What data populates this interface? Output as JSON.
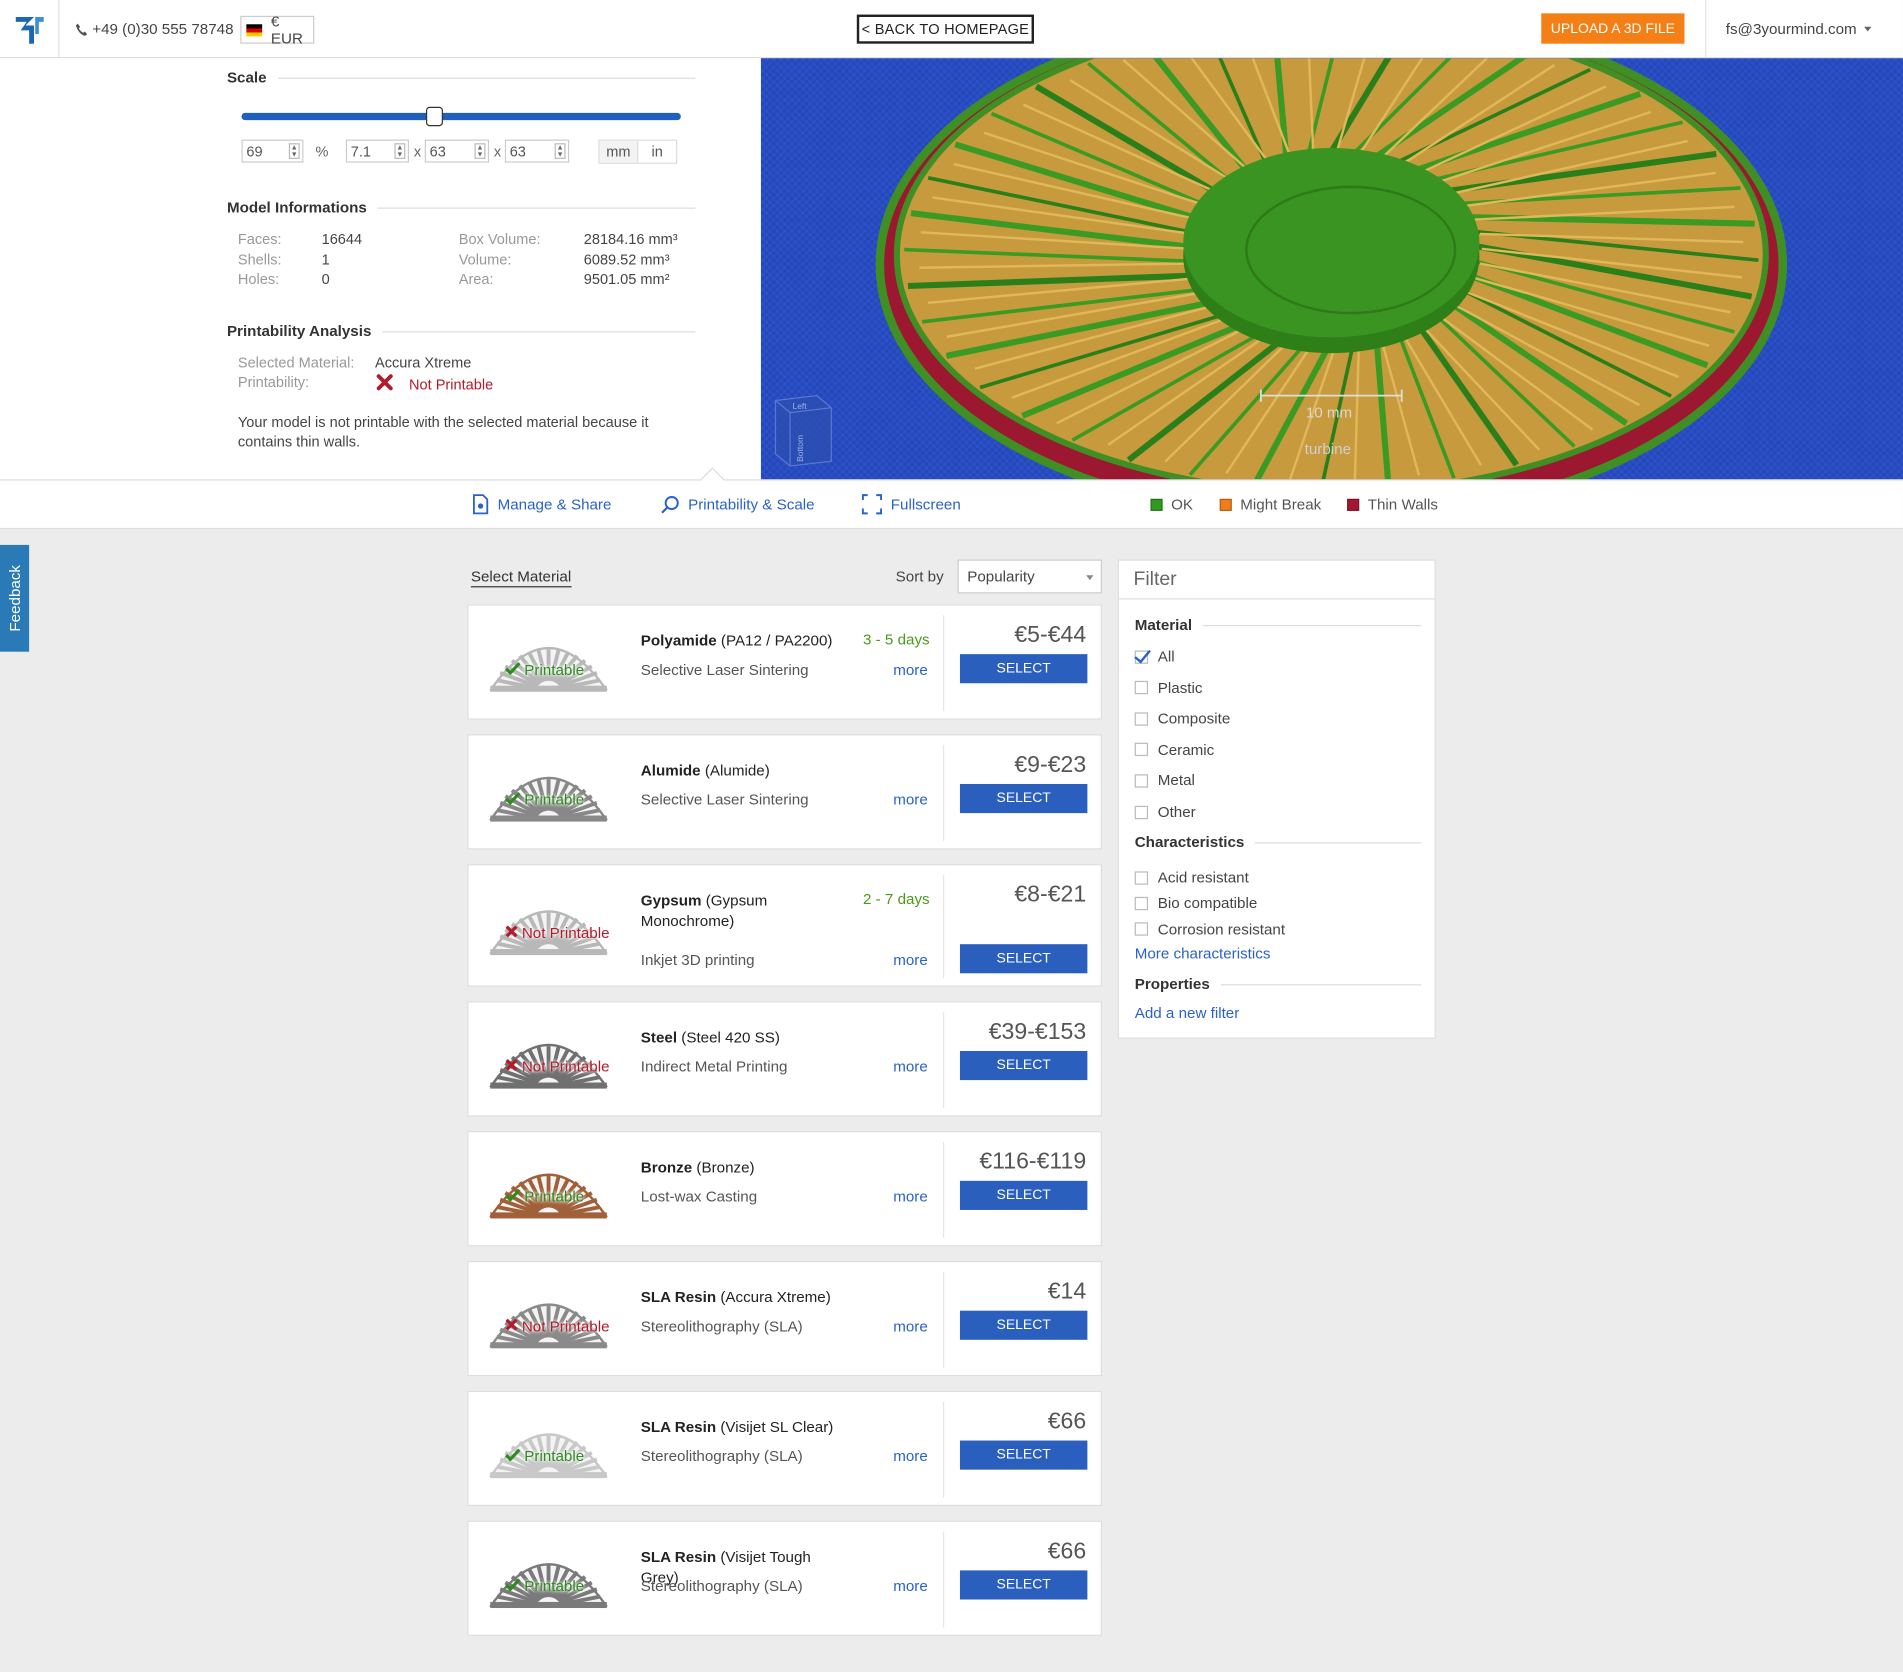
{
  "header": {
    "phone": "+49 (0)30 555 78748",
    "currency": "€ EUR",
    "back_label": "< BACK TO HOMEPAGE",
    "upload_label": "UPLOAD A 3D FILE",
    "user_email": "fs@3yourmind.com"
  },
  "scale": {
    "title": "Scale",
    "level": 0.44,
    "percent": "69",
    "percent_unit": "%",
    "dims": [
      "7.1",
      "63",
      "63"
    ],
    "sep": "x",
    "units": [
      "mm",
      "in"
    ]
  },
  "model_info": {
    "title": "Model Informations",
    "left": [
      {
        "k": "Faces:",
        "v": "16644"
      },
      {
        "k": "Shells:",
        "v": "1"
      },
      {
        "k": "Holes:",
        "v": "0"
      }
    ],
    "right": [
      {
        "k": "Box Volume:",
        "v": "28184.16 mm³"
      },
      {
        "k": "Volume:",
        "v": "6089.52 mm³"
      },
      {
        "k": "Area:",
        "v": "9501.05 mm²"
      }
    ]
  },
  "printability": {
    "title": "Printability Analysis",
    "material_key": "Selected Material:",
    "material_val": "Accura Xtreme",
    "status_key": "Printability:",
    "status_val": "Not Printable",
    "message_1": "Your model is not printable with the selected material because it",
    "message_2": "contains thin walls."
  },
  "viewer": {
    "scale_label": "10 mm",
    "model_name": "turbine",
    "cube_left": "Left",
    "cube_bottom": "Bottom"
  },
  "toolbar": {
    "manage": "Manage & Share",
    "printability": "Printability & Scale",
    "fullscreen": "Fullscreen",
    "legend": [
      {
        "label": "OK",
        "color": "#2f9a1f"
      },
      {
        "label": "Might Break",
        "color": "#f07d1a"
      },
      {
        "label": "Thin Walls",
        "color": "#a3182f"
      }
    ]
  },
  "feedback": "Feedback",
  "list": {
    "select_material": "Select Material",
    "sort_by": "Sort by",
    "sort_value": "Popularity",
    "more": "more",
    "select": "SELECT",
    "materials": [
      {
        "name": "Polyamide",
        "sub": "(PA12 / PA2200)",
        "days": "3 - 5 days",
        "process": "Selective Laser Sintering",
        "price": "€5-€44",
        "printable": true,
        "status": "Printable",
        "thumb_color": "#b8b8b8"
      },
      {
        "name": "Alumide",
        "sub": "(Alumide)",
        "days": "",
        "process": "Selective Laser Sintering",
        "price": "€9-€23",
        "printable": true,
        "status": "Printable",
        "thumb_color": "#888888"
      },
      {
        "name": "Gypsum",
        "sub": "(Gypsum Monochrome)",
        "days": "2 - 7 days",
        "process": "Inkjet 3D printing",
        "price": "€8-€21",
        "printable": false,
        "status": "Not Printable",
        "thumb_color": "#b8b8b8"
      },
      {
        "name": "Steel",
        "sub": "(Steel 420 SS)",
        "days": "",
        "process": "Indirect Metal Printing",
        "price": "€39-€153",
        "printable": false,
        "status": "Not Printable",
        "thumb_color": "#707070"
      },
      {
        "name": "Bronze",
        "sub": "(Bronze)",
        "days": "",
        "process": "Lost-wax Casting",
        "price": "€116-€119",
        "printable": true,
        "status": "Printable",
        "thumb_color": "#a0603a"
      },
      {
        "name": "SLA Resin",
        "sub": "(Accura Xtreme)",
        "days": "",
        "process": "Stereolithography (SLA)",
        "price": "€14",
        "printable": false,
        "status": "Not Printable",
        "thumb_color": "#8a8a8a"
      },
      {
        "name": "SLA Resin",
        "sub": "(Visijet SL Clear)",
        "days": "",
        "process": "Stereolithography (SLA)",
        "price": "€66",
        "printable": true,
        "status": "Printable",
        "thumb_color": "#c8c8c8"
      },
      {
        "name": "SLA Resin",
        "sub": "(Visijet Tough Grey)",
        "days": "",
        "process": "Stereolithography (SLA)",
        "price": "€66",
        "printable": true,
        "status": "Printable",
        "thumb_color": "#7a7a7a"
      }
    ]
  },
  "filter": {
    "title": "Filter",
    "material_heading": "Material",
    "materials": [
      {
        "label": "All",
        "checked": true
      },
      {
        "label": "Plastic",
        "checked": false
      },
      {
        "label": "Composite",
        "checked": false
      },
      {
        "label": "Ceramic",
        "checked": false
      },
      {
        "label": "Metal",
        "checked": false
      },
      {
        "label": "Other",
        "checked": false
      }
    ],
    "characteristics_heading": "Characteristics",
    "characteristics": [
      {
        "label": "Acid resistant",
        "checked": false
      },
      {
        "label": "Bio compatible",
        "checked": false
      },
      {
        "label": "Corrosion resistant",
        "checked": false
      }
    ],
    "more_characteristics": "More characteristics",
    "properties_heading": "Properties",
    "add_filter": "Add a new filter"
  }
}
